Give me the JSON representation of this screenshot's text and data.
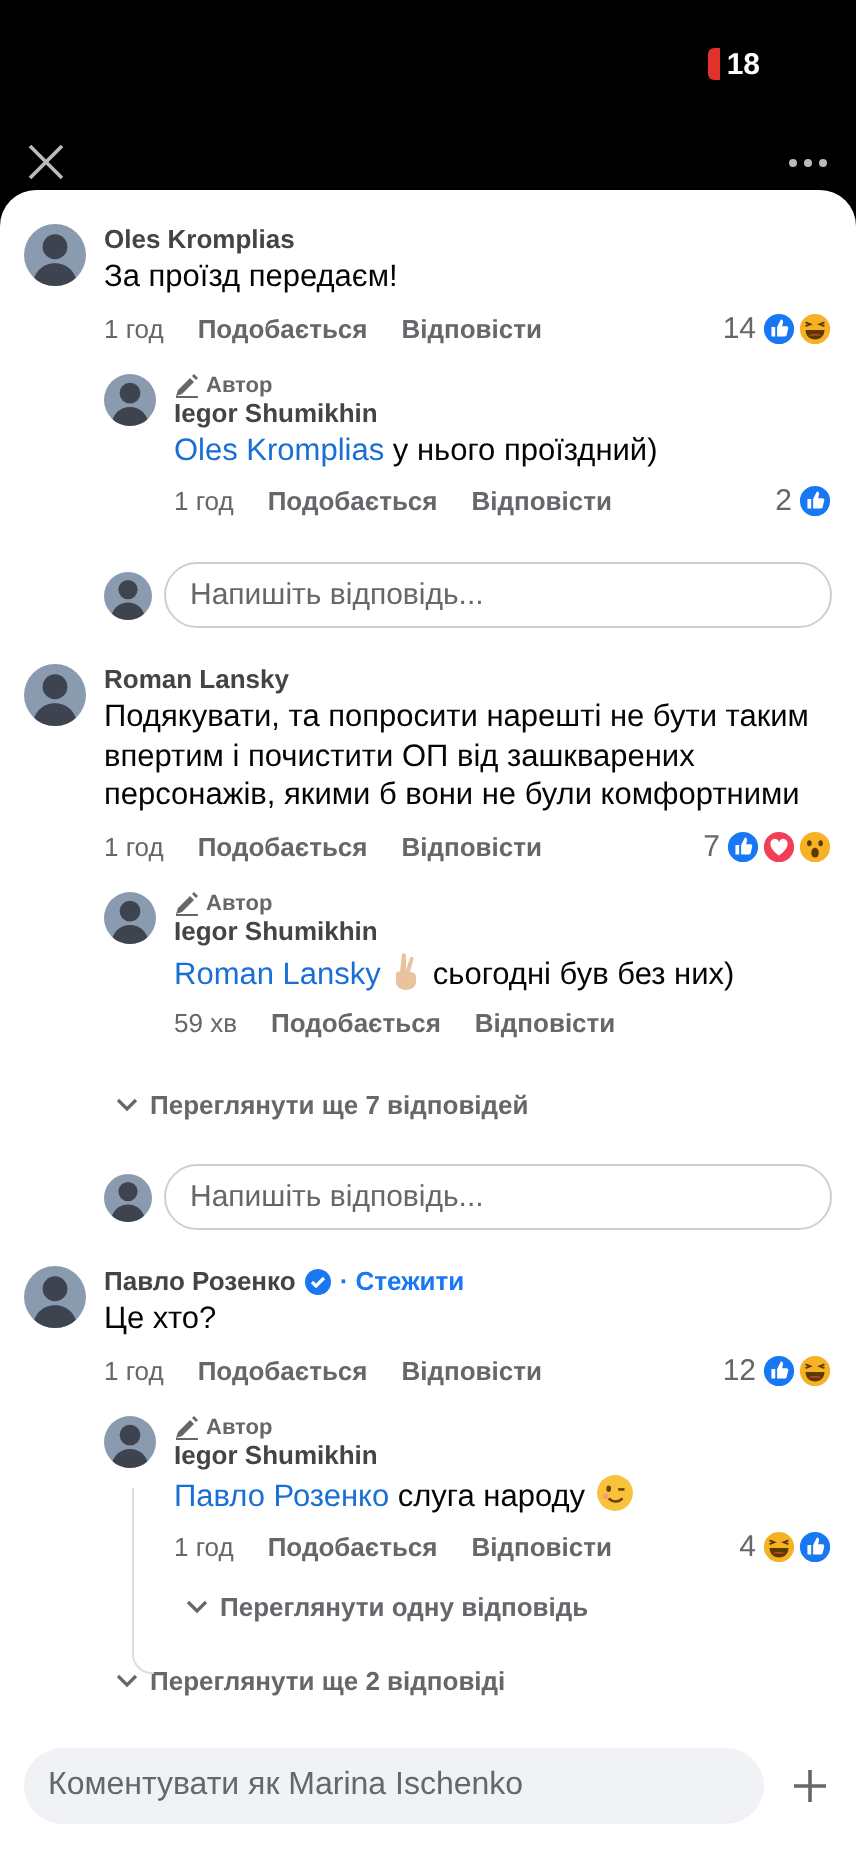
{
  "status_bar": {
    "badge": "18"
  },
  "comments": [
    {
      "author": "Oles Kromplias",
      "verified": false,
      "text": "За проїзд передаєм!",
      "time": "1 год",
      "like": "Подобається",
      "reply": "Відповісти",
      "reaction_count": "14",
      "reactions": [
        {
          "kind": "like"
        },
        {
          "kind": "haha"
        }
      ],
      "replies": [
        {
          "badge": "Автор",
          "author": "Iegor Shumikhin",
          "segments": [
            {
              "kind": "mention",
              "text": "Oles Kromplias"
            },
            {
              "kind": "text",
              "text": "у нього проїздний)"
            }
          ],
          "time": "1 год",
          "like": "Подобається",
          "reply": "Відповісти",
          "reaction_count": "2",
          "reactions": [
            {
              "kind": "like"
            }
          ]
        }
      ],
      "reply_box": {
        "placeholder": "Напишіть відповідь..."
      }
    },
    {
      "author": "Roman Lansky",
      "verified": false,
      "text": "Подякувати, та попросити нарешті не бути таким впертим і почистити ОП від зашкварених персонажів, якими б вони не були комфортними",
      "time": "1 год",
      "like": "Подобається",
      "reply": "Відповісти",
      "reaction_count": "7",
      "reactions": [
        {
          "kind": "like"
        },
        {
          "kind": "love"
        },
        {
          "kind": "wow"
        }
      ],
      "replies": [
        {
          "badge": "Автор",
          "author": "Iegor Shumikhin",
          "segments": [
            {
              "kind": "mention",
              "text": "Roman Lansky"
            },
            {
              "kind": "fingers"
            },
            {
              "kind": "text",
              "text": "сьогодні був без них)"
            }
          ],
          "time": "59 хв",
          "like": "Подобається",
          "reply": "Відповісти"
        }
      ],
      "more_replies": "Переглянути ще 7 відповідей",
      "reply_box": {
        "placeholder": "Напишіть відповідь..."
      }
    },
    {
      "author": "Павло Розенко",
      "verified": true,
      "follow": "· Стежити",
      "text": "Це хто?",
      "time": "1 год",
      "like": "Подобається",
      "reply": "Відповісти",
      "reaction_count": "12",
      "reactions": [
        {
          "kind": "like"
        },
        {
          "kind": "haha"
        }
      ],
      "replies": [
        {
          "badge": "Автор",
          "author": "Iegor Shumikhin",
          "segments": [
            {
              "kind": "mention",
              "text": "Павло Розенко"
            },
            {
              "kind": "text",
              "text": "слуга народу"
            },
            {
              "kind": "wink"
            }
          ],
          "time": "1 год",
          "like": "Подобається",
          "reply": "Відповісти",
          "reaction_count": "4",
          "reactions": [
            {
              "kind": "haha"
            },
            {
              "kind": "like"
            }
          ],
          "more_replies": "Переглянути одну відповідь"
        }
      ],
      "more_replies": "Переглянути ще 2 відповіді"
    }
  ],
  "composer": {
    "placeholder": "Коментувати як Marina Ischenko"
  }
}
